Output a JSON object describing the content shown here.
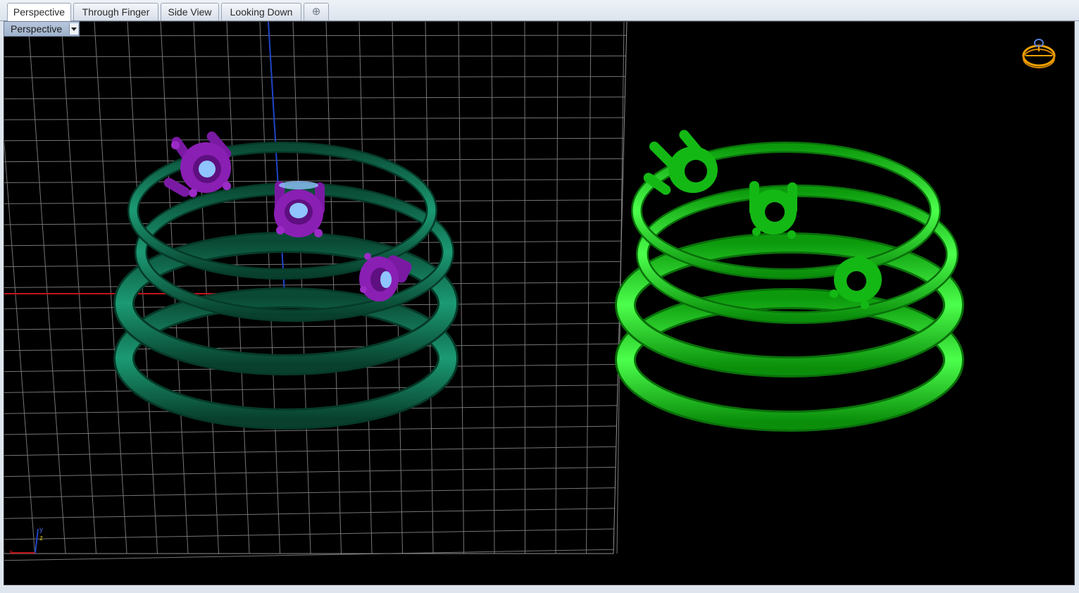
{
  "tabs": [
    {
      "label": "Perspective",
      "active": true
    },
    {
      "label": "Through Finger",
      "active": false
    },
    {
      "label": "Side View",
      "active": false
    },
    {
      "label": "Looking Down",
      "active": false
    }
  ],
  "add_tab_symbol": "⊕",
  "viewport": {
    "label": "Perspective",
    "axis_icon_labels": {
      "x": "x",
      "y": "y",
      "z": "z"
    }
  },
  "icons": [
    "dropdown-arrow-icon",
    "ring-navigator-icon",
    "world-axes-icon",
    "add-tab-icon"
  ],
  "colors": {
    "background": "#000000",
    "grid": "#8a8a8a",
    "ring_dark_green": "#0e6a4c",
    "ring_bright_green": "#1fd11f",
    "prong_purple": "#8a1fb3",
    "x_axis": "#c0151b",
    "z_axis": "#1f45c9"
  }
}
